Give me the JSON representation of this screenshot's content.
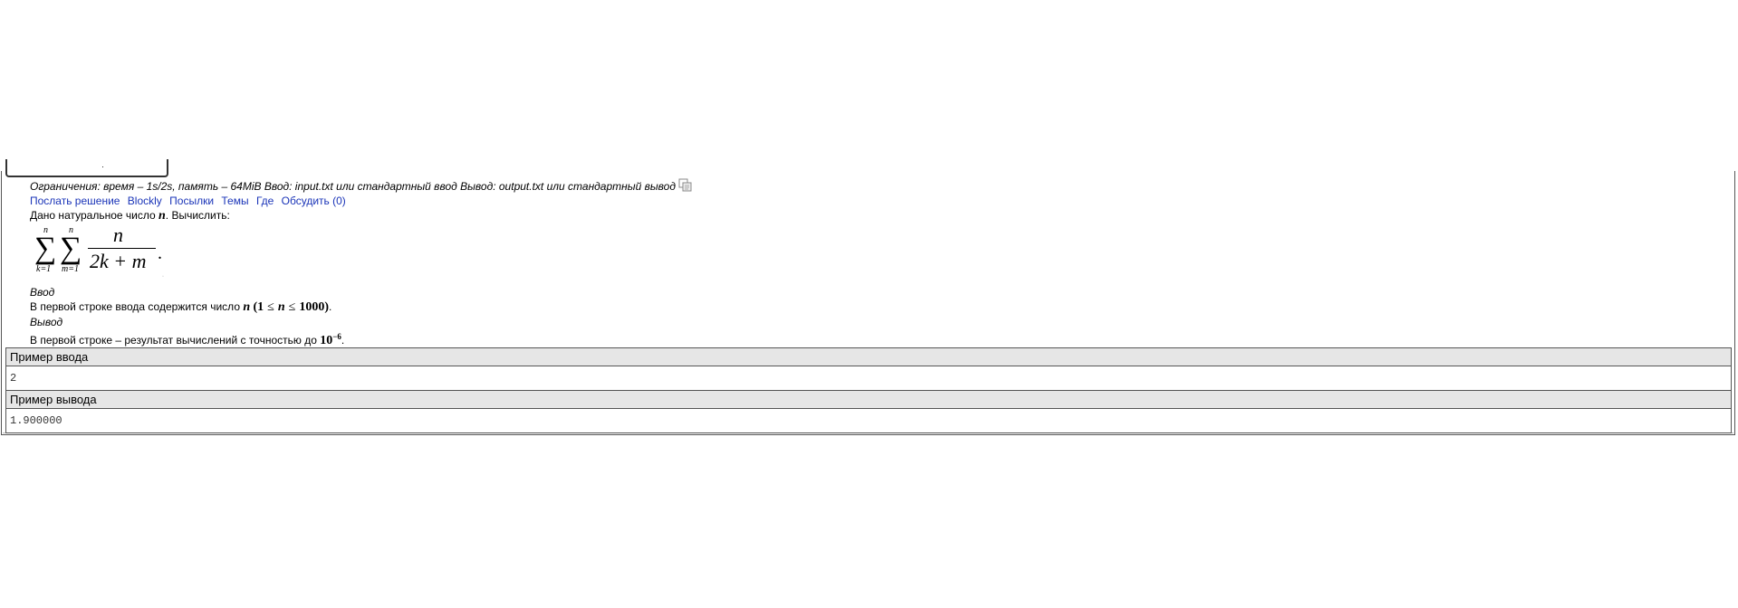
{
  "tab_stub_text": "·",
  "limits_text": "Ограничения: время – 1s/2s, память – 64MiB Ввод: input.txt или стандартный ввод Вывод: output.txt или стандартный вывод",
  "links": [
    "Послать решение",
    "Blockly",
    "Посылки",
    "Темы",
    "Где",
    "Обсудить (0)"
  ],
  "statement": {
    "intro_prefix": "Дано натуральное число",
    "intro_var": "n",
    "intro_suffix": ". Вычислить:",
    "formula": {
      "outer_upper": "n",
      "outer_lower": "k=1",
      "inner_upper": "n",
      "inner_lower": "m=1",
      "numerator": "n",
      "denominator": "2k + m",
      "end": "."
    }
  },
  "input_section": {
    "title": "Ввод",
    "text_prefix": "В первой строке ввода содержится число",
    "var": "n",
    "constraint_open": "(1",
    "le1": "≤",
    "var2": "n",
    "le2": "≤",
    "constraint_close": "1000)",
    "end": "."
  },
  "output_section": {
    "title": "Вывод",
    "text_prefix": "В первой строке – результат вычислений с точностью до",
    "base": "10",
    "exp": "−6",
    "end": "."
  },
  "samples": [
    {
      "header": "Пример ввода",
      "value": "2"
    },
    {
      "header": "Пример вывода",
      "value": "1.900000"
    }
  ]
}
